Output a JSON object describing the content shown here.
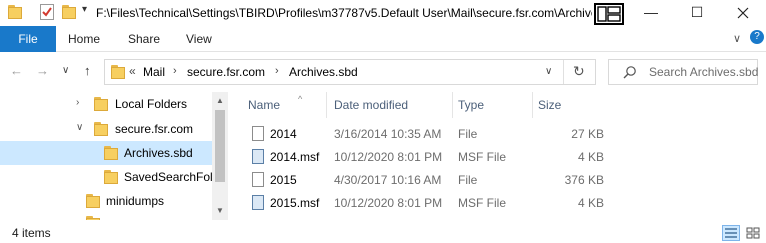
{
  "window": {
    "path": "F:\\Files\\Technical\\Settings\\TBIRD\\Profiles\\m37787v5.Default User\\Mail\\secure.fsr.com\\Archives.sbd",
    "minimize_glyph": "—",
    "maximize_glyph": "☐"
  },
  "ribbon": {
    "tabs": [
      "File",
      "Home",
      "Share",
      "View"
    ],
    "collapse_glyph": "∨",
    "help_glyph": "?"
  },
  "address": {
    "back_glyph": "←",
    "forward_glyph": "→",
    "recent_glyph": "∨",
    "up_glyph": "↑",
    "overflow": "«",
    "crumbs": [
      "Mail",
      "secure.fsr.com",
      "Archives.sbd"
    ],
    "separator": "›",
    "dropdown_glyph": "∨",
    "refresh_glyph": "↻"
  },
  "search": {
    "placeholder": "Search Archives.sbd",
    "icon_glyph": "⚲"
  },
  "nav": {
    "items": [
      {
        "label": "Local Folders",
        "chevron": "›"
      },
      {
        "label": "secure.fsr.com",
        "chevron": "∨"
      },
      {
        "label": "Archives.sbd",
        "chevron": "",
        "selected": true
      },
      {
        "label": "SavedSearchFolders",
        "chevron": ""
      },
      {
        "label": "minidumps",
        "chevron": ""
      }
    ]
  },
  "filelist": {
    "columns": [
      "Name",
      "Date modified",
      "Type",
      "Size"
    ],
    "rows": [
      {
        "name": "2014",
        "date": "3/16/2014 10:35 AM",
        "type": "File",
        "size": "27 KB",
        "icon": "file-icon"
      },
      {
        "name": "2014.msf",
        "date": "10/12/2020 8:01 PM",
        "type": "MSF File",
        "size": "4 KB",
        "icon": "msf-file-icon"
      },
      {
        "name": "2015",
        "date": "4/30/2017 10:16 AM",
        "type": "File",
        "size": "376 KB",
        "icon": "file-icon"
      },
      {
        "name": "2015.msf",
        "date": "10/12/2020 8:01 PM",
        "type": "MSF File",
        "size": "4 KB",
        "icon": "msf-file-icon"
      }
    ]
  },
  "status": {
    "item_count": "4 items"
  },
  "colors": {
    "accent": "#1979ca",
    "selection": "#cce8ff",
    "folder": "#f7cf60"
  }
}
